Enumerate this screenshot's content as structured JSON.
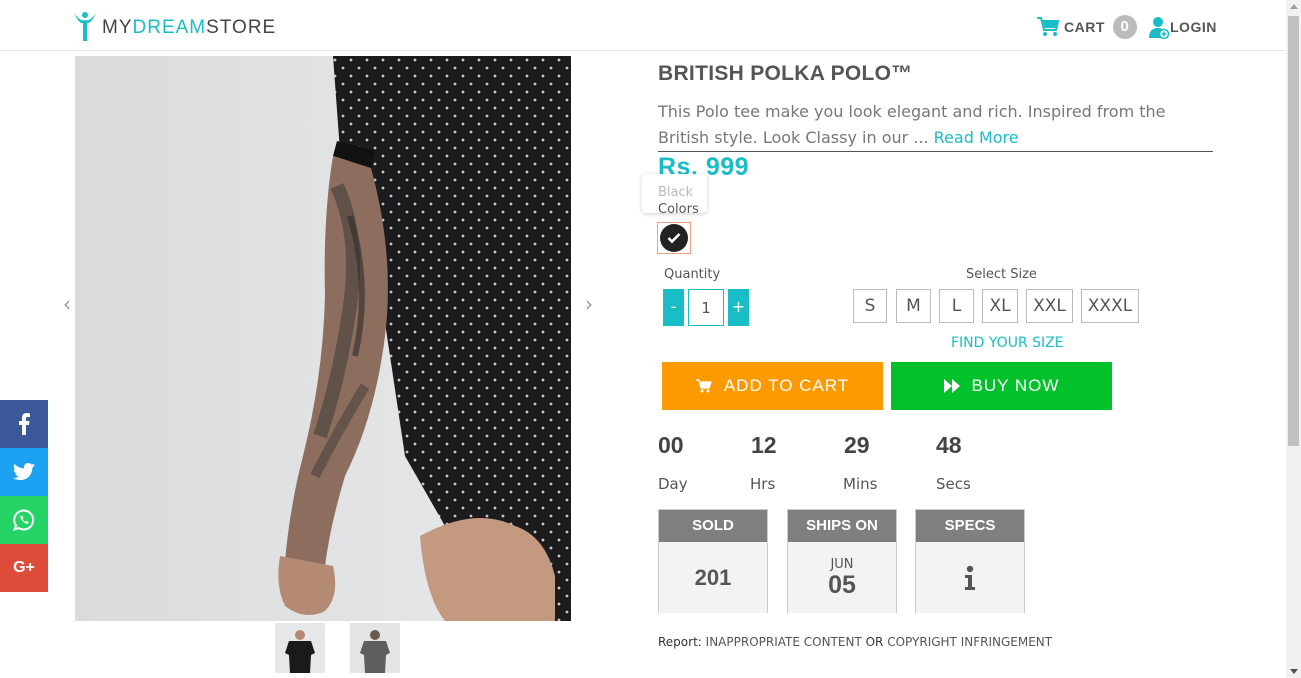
{
  "header": {
    "logo_part1": "MY",
    "logo_part2": "DREAM",
    "logo_part3": "STORE",
    "cart_label": "CART",
    "cart_count": "0",
    "login_label": "LOGIN"
  },
  "social": {
    "facebook": "f",
    "twitter": "🐦",
    "whatsapp": "✆",
    "googleplus": "G+"
  },
  "product": {
    "title": "BRITISH POLKA POLO™",
    "description": "This Polo tee make you look elegant and rich. Inspired from the British style.  Look Classy in our ...",
    "read_more": "Read More",
    "price": "Rs. 999",
    "tooltip": "Black",
    "colors_label": "Colors",
    "selected_color": "#222222"
  },
  "quantity": {
    "label": "Quantity",
    "minus": "-",
    "plus": "+",
    "value": "1"
  },
  "sizes": {
    "label": "Select Size",
    "options": [
      "S",
      "M",
      "L",
      "XL",
      "XXL",
      "XXXL"
    ],
    "find_size": "FIND YOUR SIZE"
  },
  "actions": {
    "add_to_cart": "ADD TO CART",
    "buy_now": "BUY NOW",
    "cart_color": "#fe9a01",
    "buy_color": "#03c12a"
  },
  "countdown": {
    "day": "00",
    "day_label": "Day",
    "hrs": "12",
    "hrs_label": "Hrs",
    "mins": "29",
    "mins_label": "Mins",
    "secs": "48",
    "secs_label": "Secs"
  },
  "stats": {
    "sold_label": "SOLD",
    "sold_value": "201",
    "ships_label": "SHIPS ON",
    "ships_month": "JUN",
    "ships_day": "05",
    "specs_label": "SPECS",
    "specs_icon": "i"
  },
  "report": {
    "label": "Report:",
    "link1": "INAPPROPRIATE CONTENT",
    "or": "OR",
    "link2": "COPYRIGHT INFRINGEMENT"
  },
  "gallery": {
    "prev": "‹",
    "next": "›"
  }
}
